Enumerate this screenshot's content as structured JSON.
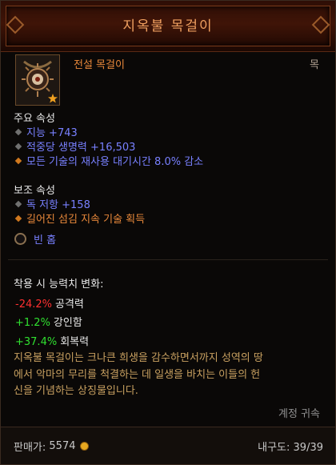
{
  "item": {
    "name": "지옥불 목걸이",
    "type": "전설 목걸이",
    "slot": "목"
  },
  "primary": {
    "heading": "주요 속성",
    "attrs": [
      "지능 +743",
      "적중당 생명력 +16,503",
      "모든 기술의 재사용 대기시간 8.0% 감소"
    ]
  },
  "secondary": {
    "heading": "보조 속성",
    "attrs": [
      "독 저항 +158",
      "길어진 섬김 지속 기술 획득"
    ]
  },
  "socket": {
    "label": "빈 홈"
  },
  "changes": {
    "heading": "착용 시 능력치 변화:",
    "rows": [
      {
        "value": "-24.2%",
        "name": "공격력"
      },
      {
        "value": "+1.2%",
        "name": "강인함"
      },
      {
        "value": "+37.4%",
        "name": "회복력"
      }
    ]
  },
  "flavor_lines": [
    "지옥불 목걸이는 크나큰 희생을 감수하면서까지 성역의 땅",
    "에서 악마의 무리를 척결하는 데 일생을 바치는 이들의 헌",
    "신을 기념하는 상징물입니다."
  ],
  "account_bound": "계정 귀속",
  "footer": {
    "sell_label": "판매가:",
    "sell_value": "5574",
    "durability_label": "내구도:",
    "durability_value": "39/39"
  },
  "colors": {
    "legendary": "#e8883a",
    "magic": "#7880ff",
    "negative": "#ff3030",
    "positive": "#30e030"
  },
  "icons": [
    "amulet-icon",
    "star-icon",
    "socket-icon",
    "gold-coin-icon"
  ]
}
